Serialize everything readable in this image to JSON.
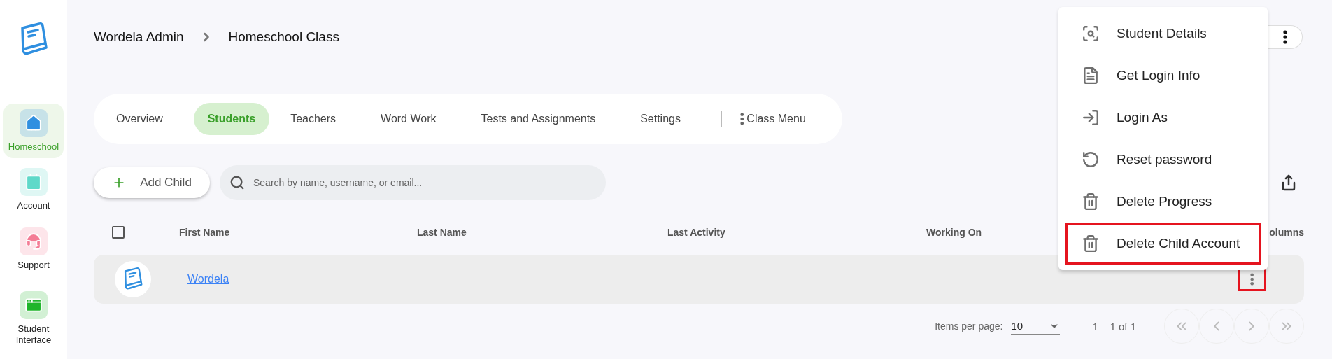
{
  "sidebar": {
    "items": [
      {
        "label": "Homeschool",
        "kind": "home",
        "selected": true,
        "color": "#2f8fe0"
      },
      {
        "label": "Account",
        "kind": "badge",
        "selected": false,
        "color": "#5fd9c9"
      },
      {
        "label": "Support",
        "kind": "support",
        "selected": false,
        "color": "#f47c95"
      },
      {
        "label": "Student Interface",
        "kind": "window",
        "selected": false,
        "color": "#1fb52a"
      }
    ]
  },
  "breadcrumb": [
    "Wordela Admin",
    "Homeschool Class"
  ],
  "tabs": [
    {
      "label": "Overview",
      "selected": false
    },
    {
      "label": "Students",
      "selected": true
    },
    {
      "label": "Teachers",
      "selected": false
    },
    {
      "label": "Word Work",
      "selected": false
    },
    {
      "label": "Tests and Assignments",
      "selected": false
    },
    {
      "label": "Settings",
      "selected": false
    }
  ],
  "class_menu": "Class Menu",
  "add_button": "Add Child",
  "search": {
    "placeholder": "Search by name, username, or email..."
  },
  "table": {
    "select_all_checked": false,
    "columns": [
      "First Name",
      "Last Name",
      "Last Activity",
      "Working On"
    ],
    "columns_button": "olumns",
    "rows": [
      {
        "first_name": "Wordela",
        "menu_highlighted": true
      }
    ]
  },
  "pagination": {
    "label": "Items per page:",
    "page_size": "10",
    "range": "1 – 1 of 1"
  },
  "context_menu": {
    "items": [
      {
        "label": "Student Details",
        "kind": "details",
        "highlighted": false
      },
      {
        "label": "Get Login Info",
        "kind": "file",
        "highlighted": false
      },
      {
        "label": "Login As",
        "kind": "login",
        "highlighted": false
      },
      {
        "label": "Reset password",
        "kind": "reset",
        "highlighted": false
      },
      {
        "label": "Delete Progress",
        "kind": "delete",
        "highlighted": false
      },
      {
        "label": "Delete Child Account",
        "kind": "delete",
        "highlighted": true
      }
    ]
  }
}
